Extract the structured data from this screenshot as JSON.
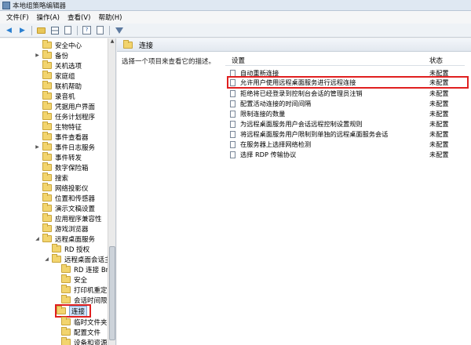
{
  "window": {
    "title": "本地组策略编辑器"
  },
  "menu": [
    {
      "label": "文件(F)"
    },
    {
      "label": "操作(A)"
    },
    {
      "label": "查看(V)"
    },
    {
      "label": "帮助(H)"
    }
  ],
  "toolbar": {
    "icons": [
      "back-arrow-icon",
      "forward-arrow-icon",
      "folder-up-icon",
      "show-hide-tree-icon",
      "properties-icon",
      "help-icon",
      "filter-icon"
    ]
  },
  "tree": {
    "items": [
      {
        "label": "安全中心",
        "expander": ""
      },
      {
        "label": "备份",
        "expander": "▶"
      },
      {
        "label": "关机选项",
        "expander": ""
      },
      {
        "label": "家庭组",
        "expander": ""
      },
      {
        "label": "联机帮助",
        "expander": ""
      },
      {
        "label": "录音机",
        "expander": ""
      },
      {
        "label": "凭据用户界面",
        "expander": ""
      },
      {
        "label": "任务计划程序",
        "expander": ""
      },
      {
        "label": "生物特征",
        "expander": ""
      },
      {
        "label": "事件查看器",
        "expander": ""
      },
      {
        "label": "事件日志服务",
        "expander": "▶"
      },
      {
        "label": "事件转发",
        "expander": ""
      },
      {
        "label": "数字保险箱",
        "expander": ""
      },
      {
        "label": "搜索",
        "expander": ""
      },
      {
        "label": "网络投影仪",
        "expander": ""
      },
      {
        "label": "位置和传感器",
        "expander": ""
      },
      {
        "label": "演示文稿设置",
        "expander": ""
      },
      {
        "label": "应用程序兼容性",
        "expander": ""
      },
      {
        "label": "游戏浏览器",
        "expander": ""
      },
      {
        "label": "远程桌面服务",
        "expander": "◢"
      },
      {
        "label": "RD 授权",
        "expander": ""
      },
      {
        "label": "远程桌面会话主",
        "expander": "◢"
      },
      {
        "label": "RD 连接 Bro",
        "expander": ""
      },
      {
        "label": "安全",
        "expander": ""
      },
      {
        "label": "打印机重定",
        "expander": ""
      },
      {
        "label": "会话时间限制",
        "expander": ""
      },
      {
        "label": "连接",
        "expander": ""
      },
      {
        "label": "临时文件夹",
        "expander": ""
      },
      {
        "label": "配置文件",
        "expander": ""
      },
      {
        "label": "设备和资源重",
        "expander": ""
      }
    ]
  },
  "right": {
    "header": "连接",
    "description": "选择一个项目来查看它的描述。",
    "columns": {
      "setting": "设置",
      "status": "状态"
    },
    "settings": [
      {
        "name": "自动重新连接",
        "status": "未配置"
      },
      {
        "name": "允许用户使用远程桌面服务进行远程连接",
        "status": "未配置"
      },
      {
        "name": "拒绝将已经登录到控制台会话的管理员注销",
        "status": "未配置"
      },
      {
        "name": "配置活动连接的时间间隔",
        "status": "未配置"
      },
      {
        "name": "限制连接的数量",
        "status": "未配置"
      },
      {
        "name": "为远程桌面服务用户会话远程控制设置规则",
        "status": "未配置"
      },
      {
        "name": "将远程桌面服务用户限制到单独的远程桌面服务会话",
        "status": "未配置"
      },
      {
        "name": "在服务器上选择网络检测",
        "status": "未配置"
      },
      {
        "name": "选择 RDP 传输协议",
        "status": "未配置"
      }
    ]
  }
}
